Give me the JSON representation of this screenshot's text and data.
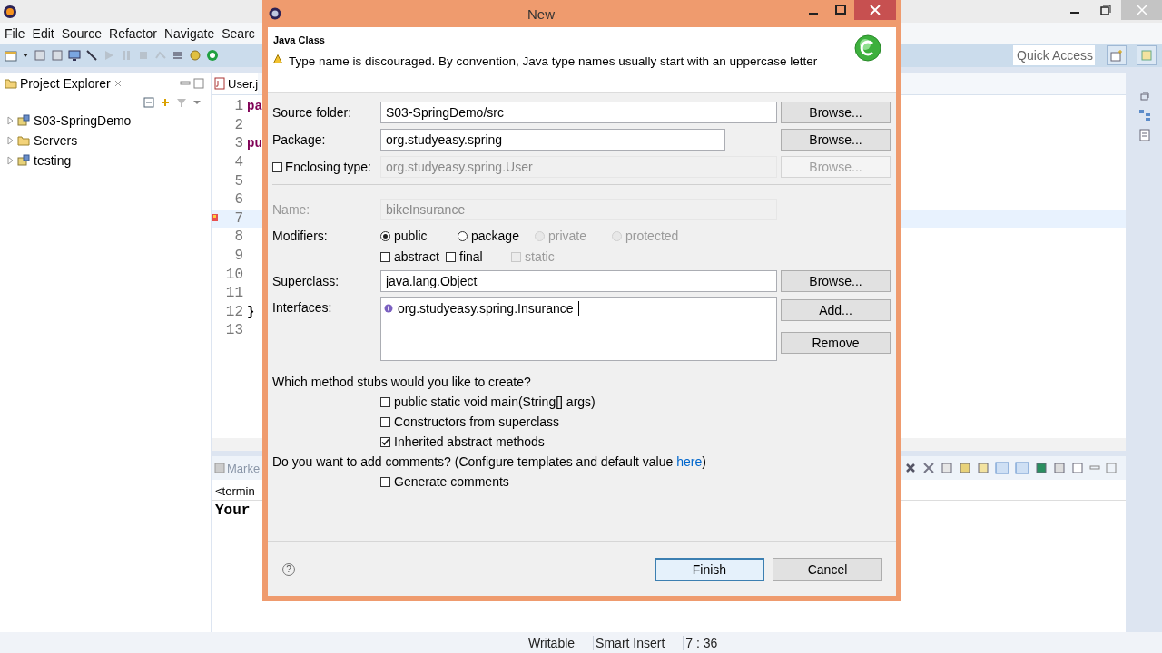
{
  "ide": {
    "menu": [
      "File",
      "Edit",
      "Source",
      "Refactor",
      "Navigate",
      "Searc"
    ],
    "quick_access": {
      "placeholder": "Quick Access"
    },
    "project_explorer": {
      "title": "Project Explorer",
      "items": [
        {
          "label": "S03-SpringDemo",
          "kind": "project",
          "expanded": false
        },
        {
          "label": "Servers",
          "kind": "folder",
          "expanded": false
        },
        {
          "label": "testing",
          "kind": "project",
          "expanded": false
        }
      ]
    },
    "editor": {
      "tab": "User.j",
      "lines": [
        {
          "number": "1",
          "code": "pa",
          "current": false,
          "marker": false
        },
        {
          "number": "2",
          "current": false,
          "marker": false
        },
        {
          "number": "3",
          "code": "pu",
          "current": false,
          "marker": false
        },
        {
          "number": "4",
          "current": false,
          "marker": false
        },
        {
          "number": "5",
          "current": false,
          "marker": false
        },
        {
          "number": "6",
          "current": false,
          "marker": false
        },
        {
          "number": "7",
          "current": true,
          "marker": true
        },
        {
          "number": "8",
          "current": false,
          "marker": false
        },
        {
          "number": "9",
          "current": false,
          "marker": false
        },
        {
          "number": "10",
          "current": false,
          "marker": false
        },
        {
          "number": "11",
          "current": false,
          "marker": false
        },
        {
          "number": "12",
          "code": "}",
          "current": false,
          "marker": false
        },
        {
          "number": "13",
          "current": false,
          "marker": false
        }
      ]
    },
    "console": {
      "tab": "Marke",
      "header": "<termin",
      "output": "Your"
    },
    "status_bar": [
      "Writable",
      "Smart Insert",
      "7 : 36"
    ]
  },
  "dialog": {
    "title": "New",
    "header": {
      "title": "Java Class",
      "message": "Type name is discouraged. By convention, Java type names usually start with an uppercase letter"
    },
    "source_folder": {
      "label": "Source folder:",
      "value": "S03-SpringDemo/src",
      "button": {
        "label": "Browse...",
        "disabled": false
      }
    },
    "package": {
      "label": "Package:",
      "value": "org.studyeasy.spring",
      "button": {
        "label": "Browse...",
        "disabled": false
      }
    },
    "enclosing_type": {
      "label": "Enclosing type:",
      "checked": false,
      "value": "org.studyeasy.spring.User",
      "disabled": true,
      "button": {
        "label": "Browse...",
        "disabled": true
      }
    },
    "name": {
      "label": "Name:",
      "value": "bikeInsurance",
      "disabled": true
    },
    "modifiers": {
      "label": "Modifiers:",
      "access": [
        {
          "label": "public",
          "selected": true,
          "disabled": false
        },
        {
          "label": "package",
          "selected": false,
          "disabled": false
        },
        {
          "label": "private",
          "selected": false,
          "disabled": true
        },
        {
          "label": "protected",
          "selected": false,
          "disabled": true
        }
      ],
      "flags": [
        {
          "label": "abstract",
          "checked": false,
          "disabled": false
        },
        {
          "label": "final",
          "checked": false,
          "disabled": false
        },
        {
          "label": "static",
          "checked": false,
          "disabled": true
        }
      ]
    },
    "superclass": {
      "label": "Superclass:",
      "value": "java.lang.Object",
      "button": {
        "label": "Browse...",
        "disabled": false
      }
    },
    "interfaces": {
      "label": "Interfaces:",
      "items": [
        "org.studyeasy.spring.Insurance"
      ],
      "buttons": [
        {
          "label": "Add...",
          "disabled": false
        },
        {
          "label": "Remove",
          "disabled": false
        }
      ]
    },
    "method_stubs": {
      "question": "Which method stubs would you like to create?",
      "options": [
        {
          "label": "public static void main(String[] args)",
          "checked": false
        },
        {
          "label": "Constructors from superclass",
          "checked": false
        },
        {
          "label": "Inherited abstract methods",
          "checked": true
        }
      ]
    },
    "comments": {
      "before": "Do you want to add comments? (Configure templates and default value ",
      "link": "here",
      "after": ")",
      "options": [
        {
          "label": "Generate comments",
          "checked": false
        }
      ]
    },
    "help": "?",
    "buttons": [
      {
        "label": "Finish",
        "default": true
      },
      {
        "label": "Cancel",
        "default": false
      }
    ]
  }
}
